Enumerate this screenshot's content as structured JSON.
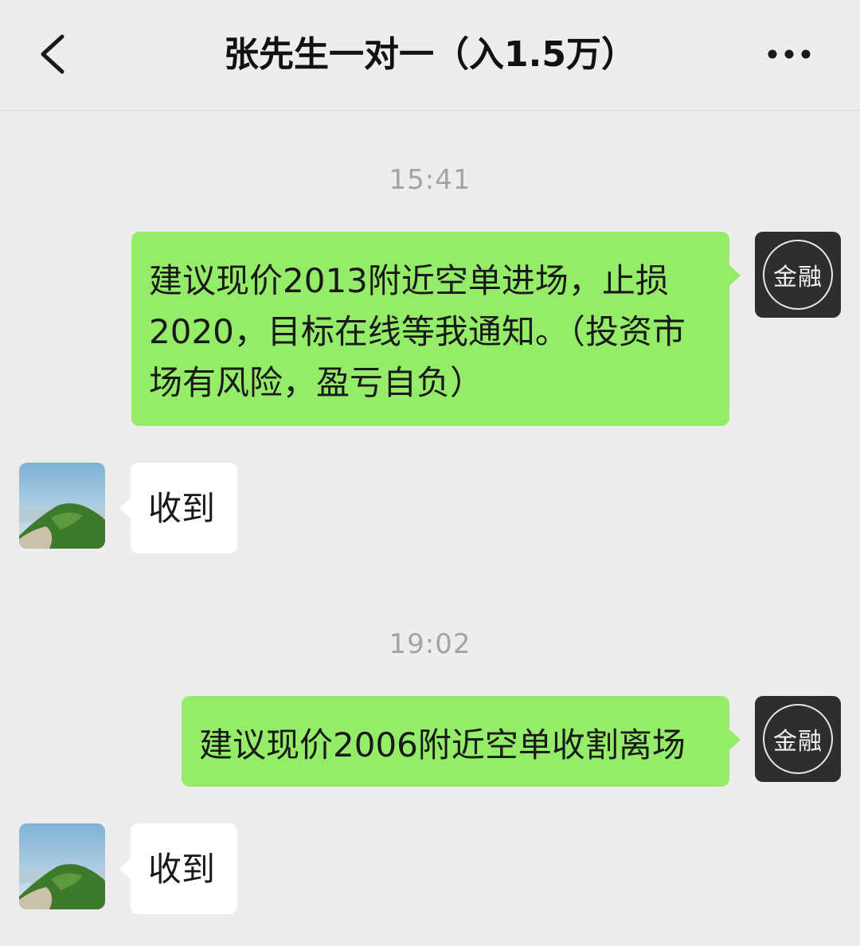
{
  "header": {
    "title": "张先生一对一（入1.5万）",
    "back_icon": "chevron-left-icon",
    "more_icon": "more-dots-icon"
  },
  "messages": [
    {
      "type": "time",
      "text": "15:41"
    },
    {
      "type": "sent",
      "text": "建议现价2013附近空单进场，止损2020，目标在线等我通知。（投资市场有风险，盈亏自负）",
      "avatar_text": "金融"
    },
    {
      "type": "received",
      "text": "收到"
    },
    {
      "type": "time",
      "text": "19:02"
    },
    {
      "type": "sent",
      "text": "建议现价2006附近空单收割离场",
      "avatar_text": "金融"
    },
    {
      "type": "received",
      "text": "收到"
    }
  ],
  "colors": {
    "background": "#ededed",
    "sent_bubble": "#95ec69",
    "received_bubble": "#ffffff",
    "timestamp": "#a3a3a3"
  }
}
